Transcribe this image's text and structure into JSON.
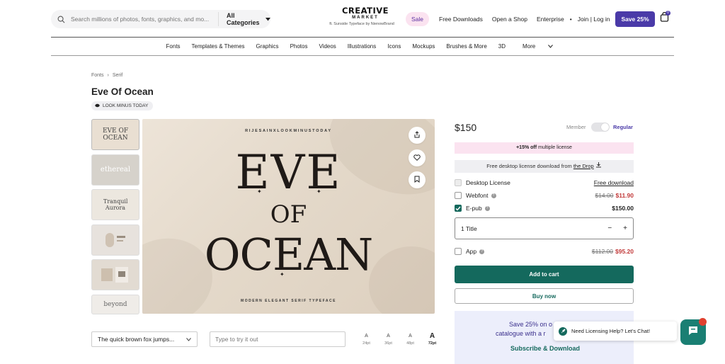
{
  "header": {
    "search_placeholder": "Search millions of photos, fonts, graphics, and mo...",
    "category_label": "All Categories",
    "logo_main": "CREATIVE",
    "logo_sub": "MARKET",
    "logo_featured": "ft. Sunside Typeface by NienowBrand",
    "sale_label": "Sale",
    "links": [
      "Free Downloads",
      "Open a Shop",
      "Enterprise"
    ],
    "join_login": "Join | Log in",
    "save_button": "Save 25%",
    "cart_count": "0",
    "accent_color": "#4a3aa8"
  },
  "category_nav": [
    "Fonts",
    "Templates & Themes",
    "Graphics",
    "Photos",
    "Videos",
    "Illustrations",
    "Icons",
    "Mockups",
    "Brushes & More",
    "3D",
    "More"
  ],
  "breadcrumb": [
    "Fonts",
    "Serif"
  ],
  "product": {
    "title": "Eve Of Ocean",
    "shop": "LOOK MINUS TODAY",
    "thumbnails": [
      "EVE OF OCEAN",
      "ethereal",
      "Tranquil Aurora",
      "",
      "",
      "beyond"
    ],
    "preview": {
      "top_text": "RIJESAINXLOOKMINUSTODAY",
      "line1": "EVE",
      "line2": "OF",
      "line3": "OCEAN",
      "bottom_text": "MODERN ELEGANT SERIF TYPEFACE"
    }
  },
  "tester": {
    "select_value": "The quick brown fox jumps...",
    "input_placeholder": "Type to try it out",
    "sizes": [
      {
        "glyph": "A",
        "label": "24pt"
      },
      {
        "glyph": "A",
        "label": "36pt"
      },
      {
        "glyph": "A",
        "label": "48pt"
      },
      {
        "glyph": "A",
        "label": "72pt"
      }
    ]
  },
  "purchase": {
    "price": "$150",
    "member_label": "Member",
    "regular_label": "Regular",
    "promo_bold": "+15% off",
    "promo_rest": " multiple license",
    "drop_text": "Free desktop license download from ",
    "drop_link": "the Drop",
    "licenses": [
      {
        "name": "Desktop License",
        "value": "Free download",
        "state": "disabled"
      },
      {
        "name": "Webfont",
        "old": "$14.00",
        "new": "$11.90",
        "state": "off"
      },
      {
        "name": "E-pub",
        "value": "$150.00",
        "state": "on"
      },
      {
        "name": "App",
        "old": "$112.00",
        "new": "$95.20",
        "state": "off"
      }
    ],
    "quantity_label": "1 Title",
    "add_to_cart": "Add to cart",
    "buy_now": "Buy now",
    "sub_line1": "Save 25% on o",
    "sub_line2": "catalogue with a r",
    "sub_link": "Subscribe & Download",
    "brand_green": "#14695d"
  },
  "chat": {
    "popup_text": "Need Licensing Help? Let's Chat!"
  }
}
